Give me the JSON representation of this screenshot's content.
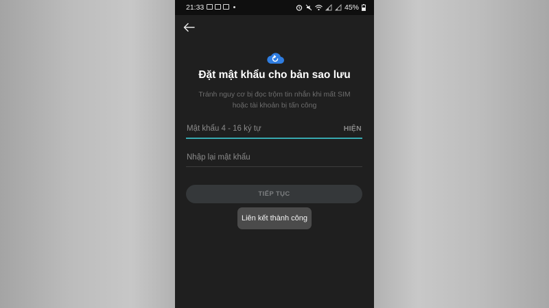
{
  "status_bar": {
    "time": "21:33",
    "battery_percent": "45%",
    "notification_icons": [
      "image-icon",
      "messenger-icon",
      "messenger-icon",
      "more-dot-icon"
    ],
    "system_icons": [
      "alarm-icon",
      "mute-icon",
      "wifi-icon",
      "signal-icon",
      "signal-icon",
      "battery-icon"
    ]
  },
  "header": {
    "back_icon": "arrow-left-icon"
  },
  "hero": {
    "icon": "cloud-backup-icon",
    "icon_color": "#2f7de1",
    "title": "Đặt mật khẩu cho bản sao lưu",
    "subtitle_line1": "Tránh nguy cơ bị đọc trộm tin nhắn khi mất SIM",
    "subtitle_line2": "hoặc tài khoản bị tấn công"
  },
  "form": {
    "password_placeholder": "Mật khẩu 4 - 16 ký tự",
    "show_label": "HIỆN",
    "confirm_placeholder": "Nhập lại mật khẩu",
    "continue_label": "TIẾP TỤC",
    "accent_color": "#38aab2"
  },
  "toast": {
    "message": "Liên kết thành công"
  }
}
